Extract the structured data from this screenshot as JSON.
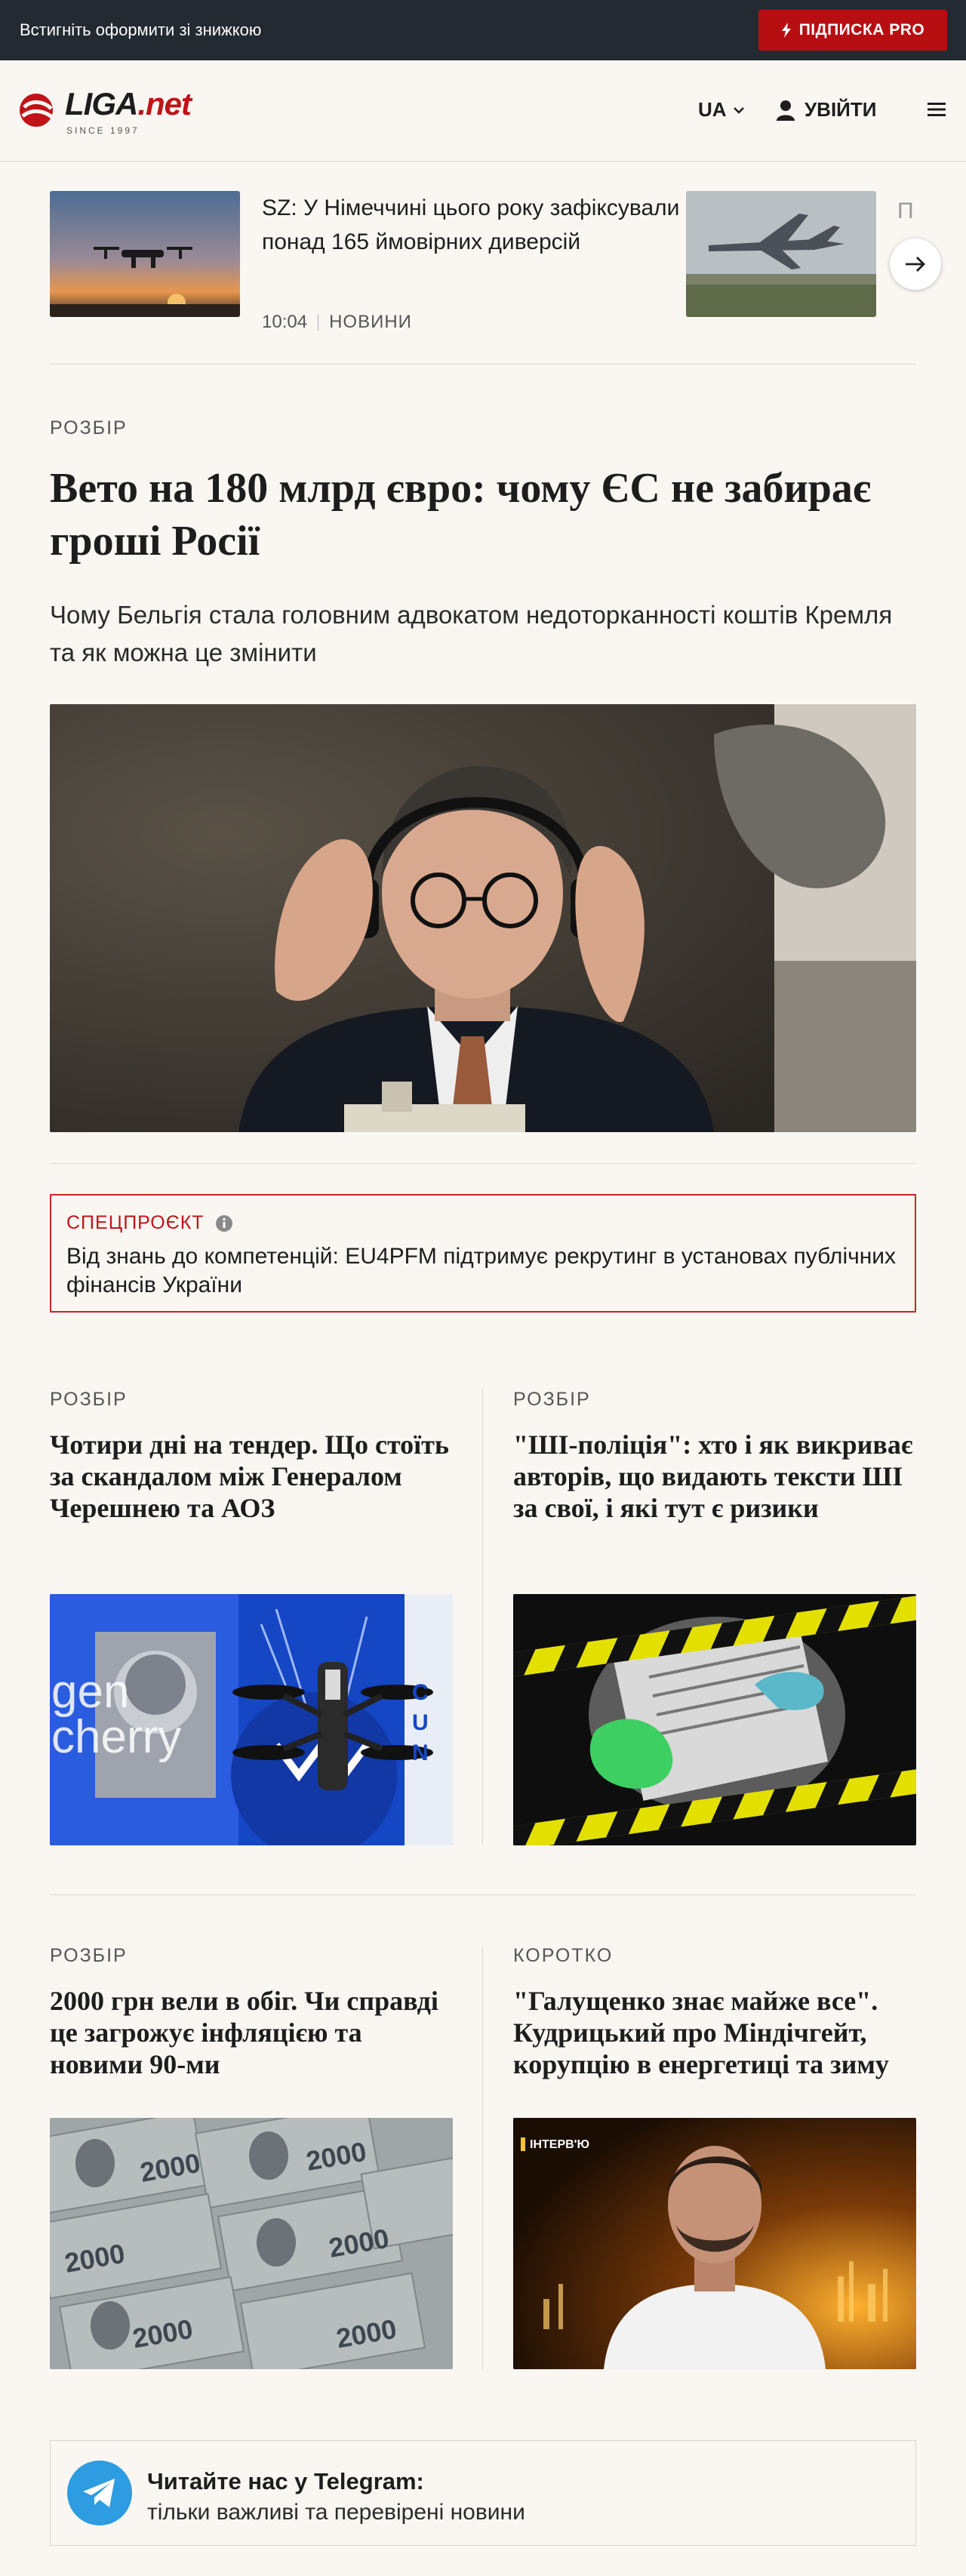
{
  "promo": {
    "text": "Встигніть оформити зі знижкою",
    "button": "ПІДПИСКА PRO"
  },
  "header": {
    "logo_main": "LIGA",
    "logo_net": ".net",
    "logo_since": "SINCE 1997",
    "lang": "UA",
    "login": "УВІЙТИ",
    "icons": [
      "menu-icon",
      "user-icon",
      "chevron-down-icon",
      "bolt-icon"
    ]
  },
  "carousel": {
    "items": [
      {
        "title": "SZ: У Німеччині цього року зафіксували понад 165 ймовірних диверсій",
        "time": "10:04",
        "category": "НОВИНИ"
      },
      {
        "title": "П"
      }
    ]
  },
  "main": {
    "kicker": "РОЗБІР",
    "title": "Вето на 180 млрд євро: чому ЄС не забирає гроші Росії",
    "lead": "Чому Бельгія стала головним адвокатом недоторканності коштів Кремля та як можна це змінити"
  },
  "special": {
    "label": "СПЕЦПРОЄКТ",
    "title": "Від знань до компетенцій: EU4PFM підтримує рекрутинг в установах публічних фінансів України"
  },
  "cards": [
    {
      "kicker": "РОЗБІР",
      "title": "Чотири дні на тендер. Що стоїть за скандалом між Генералом Черешнею та АОЗ"
    },
    {
      "kicker": "РОЗБІР",
      "title": "\"ШІ-поліція\": хто і як викриває авторів, що видають тексти ШІ за свої, і які тут є ризики"
    },
    {
      "kicker": "РОЗБІР",
      "title": "2000 грн вели в обіг. Чи справді це загрожує інфляцією та новими 90-ми"
    },
    {
      "kicker": "КОРОТКО",
      "title": "\"Галущенко знає майже все\". Кудрицький про Міндічгейт, корупцію в енергетиці та зиму"
    }
  ],
  "card_images": {
    "cherry_text_1": "gen",
    "cherry_text_2": "cherry",
    "interview_tag": "ІНТЕРВ'Ю",
    "banknote_value": "2000"
  },
  "telegram": {
    "title": "Читайте нас у Telegram:",
    "subtitle": "тільки важливі та перевірені новини"
  },
  "colors": {
    "brand_red": "#c01418",
    "promo_bg": "#232a31",
    "page_bg": "#faf7f3",
    "telegram_blue": "#2d9ce0"
  }
}
